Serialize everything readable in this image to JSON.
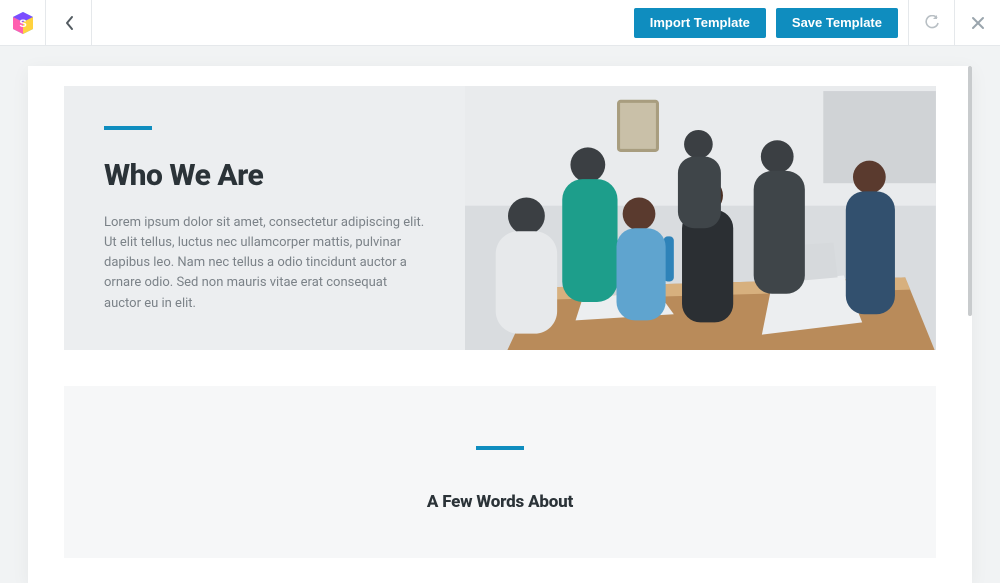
{
  "toolbar": {
    "import_label": "Import Template",
    "save_label": "Save Template"
  },
  "hero": {
    "title": "Who We Are",
    "body": "Lorem ipsum dolor sit amet, consectetur adipiscing elit. Ut elit tellus, luctus nec ullamcorper mattis, pulvinar dapibus leo. Nam nec tellus a odio tincidunt auctor a ornare odio. Sed non mauris vitae erat consequat auctor eu in elit."
  },
  "about": {
    "title": "A Few Words About"
  },
  "colors": {
    "accent": "#0f8dbf"
  }
}
